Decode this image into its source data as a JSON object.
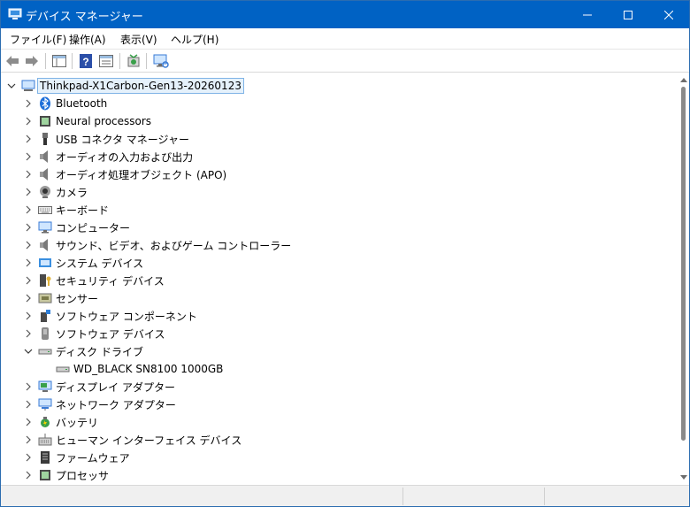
{
  "window": {
    "title": "デバイス マネージャー"
  },
  "menu": {
    "file": "ファイル(F)",
    "action": "操作(A)",
    "view": "表示(V)",
    "help": "ヘルプ(H)"
  },
  "toolbar": {
    "icons": [
      "back-arrow-icon",
      "forward-arrow-icon",
      "properties-icon",
      "help-icon",
      "show-hide-console-tree-icon",
      "update-driver-icon",
      "scan-hardware-icon"
    ]
  },
  "tree": {
    "root": "Thinkpad-X1Carbon-Gen13-20260123",
    "items": [
      {
        "label": "Bluetooth",
        "icon": "bluetooth-icon",
        "expanded": false
      },
      {
        "label": "Neural processors",
        "icon": "chip-icon",
        "expanded": false
      },
      {
        "label": "USB コネクタ マネージャー",
        "icon": "usb-connector-icon",
        "expanded": false
      },
      {
        "label": "オーディオの入力および出力",
        "icon": "speaker-icon",
        "expanded": false
      },
      {
        "label": "オーディオ処理オブジェクト (APO)",
        "icon": "speaker-icon",
        "expanded": false
      },
      {
        "label": "カメラ",
        "icon": "camera-icon",
        "expanded": false
      },
      {
        "label": "キーボード",
        "icon": "keyboard-icon",
        "expanded": false
      },
      {
        "label": "コンピューター",
        "icon": "monitor-icon",
        "expanded": false
      },
      {
        "label": "サウンド、ビデオ、およびゲーム コントローラー",
        "icon": "speaker-icon",
        "expanded": false
      },
      {
        "label": "システム デバイス",
        "icon": "system-folder-icon",
        "expanded": false
      },
      {
        "label": "セキュリティ デバイス",
        "icon": "security-key-icon",
        "expanded": false
      },
      {
        "label": "センサー",
        "icon": "sensor-icon",
        "expanded": false
      },
      {
        "label": "ソフトウェア コンポーネント",
        "icon": "software-component-icon",
        "expanded": false
      },
      {
        "label": "ソフトウェア デバイス",
        "icon": "software-device-icon",
        "expanded": false
      },
      {
        "label": "ディスク ドライブ",
        "icon": "disk-drive-icon",
        "expanded": true
      },
      {
        "label": "WD_BLACK SN8100 1000GB",
        "icon": "disk-drive-icon",
        "child": true
      },
      {
        "label": "ディスプレイ アダプター",
        "icon": "display-adapter-icon",
        "expanded": false
      },
      {
        "label": "ネットワーク アダプター",
        "icon": "network-adapter-icon",
        "expanded": false
      },
      {
        "label": "バッテリ",
        "icon": "battery-icon",
        "expanded": false
      },
      {
        "label": "ヒューマン インターフェイス デバイス",
        "icon": "hid-icon",
        "expanded": false
      },
      {
        "label": "ファームウェア",
        "icon": "firmware-icon",
        "expanded": false
      },
      {
        "label": "プロセッサ",
        "icon": "processor-icon",
        "expanded": false
      }
    ]
  },
  "colors": {
    "titlebar": "#0062c4",
    "selection_border": "#7fb3e6",
    "selection_fill": "#e5f1fb"
  }
}
